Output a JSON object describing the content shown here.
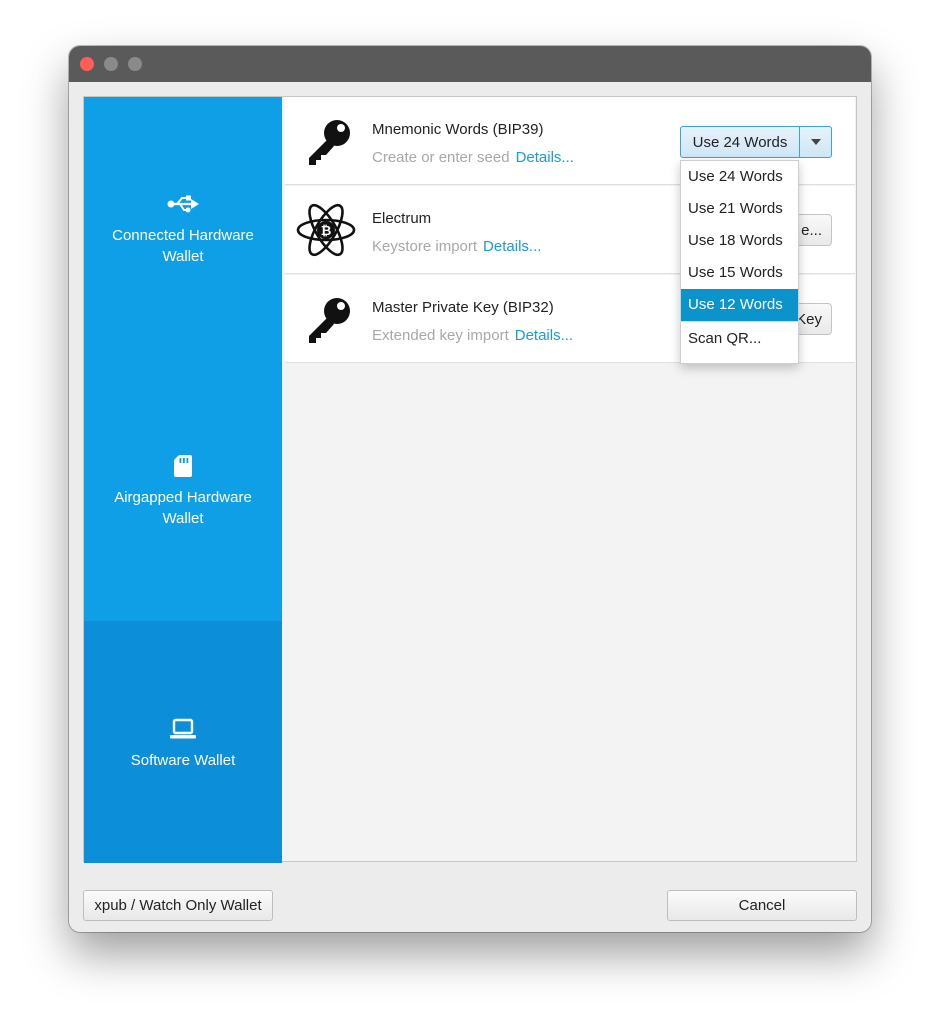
{
  "sidebar": {
    "items": [
      {
        "label": "Connected Hardware\nWallet",
        "icon": "usb-icon",
        "selected": false
      },
      {
        "label": "Airgapped Hardware\nWallet",
        "icon": "sd-card-icon",
        "selected": false
      },
      {
        "label": "Software Wallet",
        "icon": "laptop-icon",
        "selected": true
      }
    ]
  },
  "wallets": [
    {
      "title": "Mnemonic Words (BIP39)",
      "subtitle": "Create or enter seed",
      "details": "Details...",
      "icon": "key-icon",
      "button": "Use 24 Words"
    },
    {
      "title": "Electrum",
      "subtitle": "Keystore import",
      "details": "Details...",
      "icon": "electrum-bitcoin-icon",
      "button_visible_fragment": "e..."
    },
    {
      "title": "Master Private Key (BIP32)",
      "subtitle": "Extended key import",
      "details": "Details...",
      "icon": "key-icon",
      "button_visible_fragment": "Key"
    }
  ],
  "dropdown": {
    "items": [
      "Use 24 Words",
      "Use 21 Words",
      "Use 18 Words",
      "Use 15 Words",
      "Use 12 Words",
      "Scan QR..."
    ],
    "highlighted": "Use 12 Words"
  },
  "footer": {
    "watch_only_label": "xpub / Watch Only Wallet",
    "cancel_label": "Cancel"
  },
  "colors": {
    "sidebar": "#0f9fe6",
    "sidebar_selected": "#0d8ed8",
    "link": "#1a9bd7",
    "highlight": "#0b93cc"
  }
}
